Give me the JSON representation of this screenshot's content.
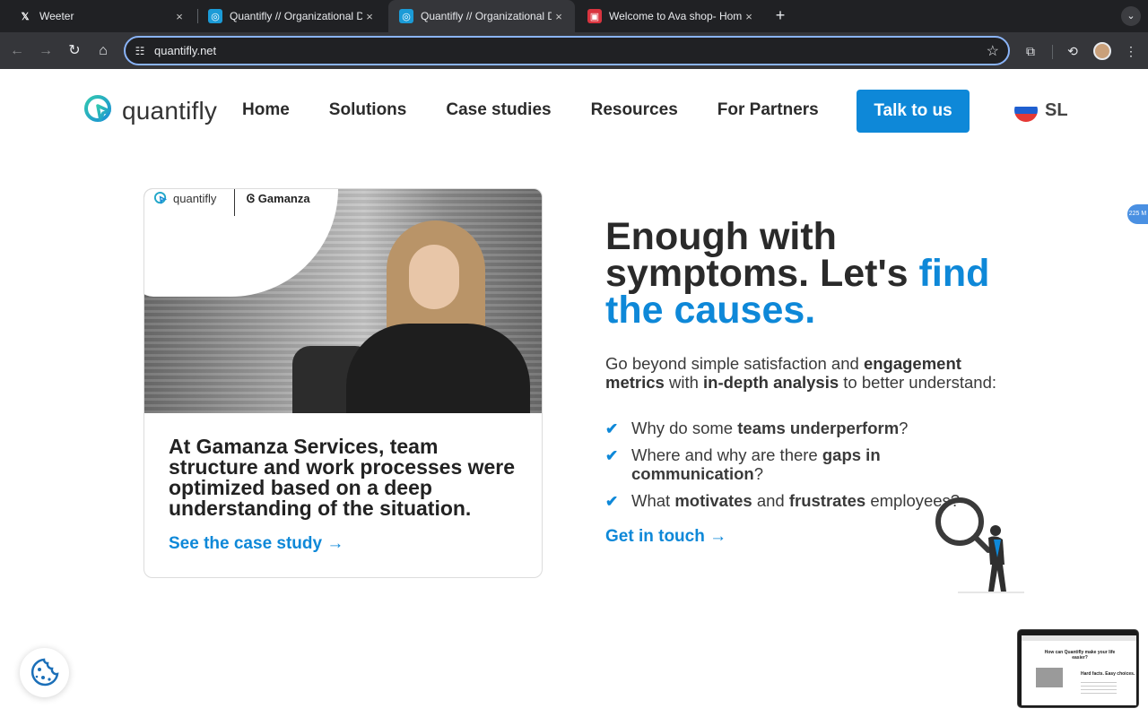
{
  "browser": {
    "tabs": [
      {
        "title": "Weeter",
        "favicon": "x-logo",
        "active": false
      },
      {
        "title": "Quantifly // Organizational Dia",
        "favicon": "quantifly-logo",
        "active": false
      },
      {
        "title": "Quantifly // Organizational Dia",
        "favicon": "quantifly-logo",
        "active": true
      },
      {
        "title": "Welcome to Ava shop- Home",
        "favicon": "ava-shop-logo",
        "active": false
      }
    ],
    "close_glyph": "×",
    "new_tab_glyph": "+",
    "url": "quantifly.net"
  },
  "site": {
    "logo_text": "quantifly",
    "nav": [
      "Home",
      "Solutions",
      "Case studies",
      "Resources",
      "For Partners"
    ],
    "cta_label": "Talk to us",
    "language": "SL",
    "side_badge": "225 M"
  },
  "case_card": {
    "partner_logo_left": "quantifly",
    "partner_logo_right": "Gamanza",
    "title": "At Gamanza Services, team structure and work processes were optimized based on a deep understanding of the situation.",
    "link_label": "See the case study →"
  },
  "hero": {
    "title_line_1": "Enough with",
    "title_line_2": "symptoms. Let's ",
    "title_accent": "find the causes.",
    "intro": {
      "t1": "Go beyond simple satisfaction and ",
      "b1": "engagement metrics",
      "t2": " with ",
      "b2": "in-depth analysis",
      "t3": " to better understand:"
    },
    "bullets": [
      {
        "pre": "Why do some ",
        "bold": "teams underperform",
        "post": "?"
      },
      {
        "pre": "Where and why are there ",
        "bold": "gaps in communication",
        "post": "?"
      },
      {
        "pre": "What ",
        "bold": "motivates",
        "mid": " and ",
        "bold2": "frustrates",
        "post": " employees?"
      }
    ],
    "link_label": "Get in touch →"
  },
  "pip_preview": {
    "title": "How can Quantifly make your life easier?",
    "heading": "Hard facts. Easy choices."
  },
  "colors": {
    "accent": "#0e88d8",
    "chrome_dark": "#202124",
    "chrome_toolbar": "#35363a"
  }
}
